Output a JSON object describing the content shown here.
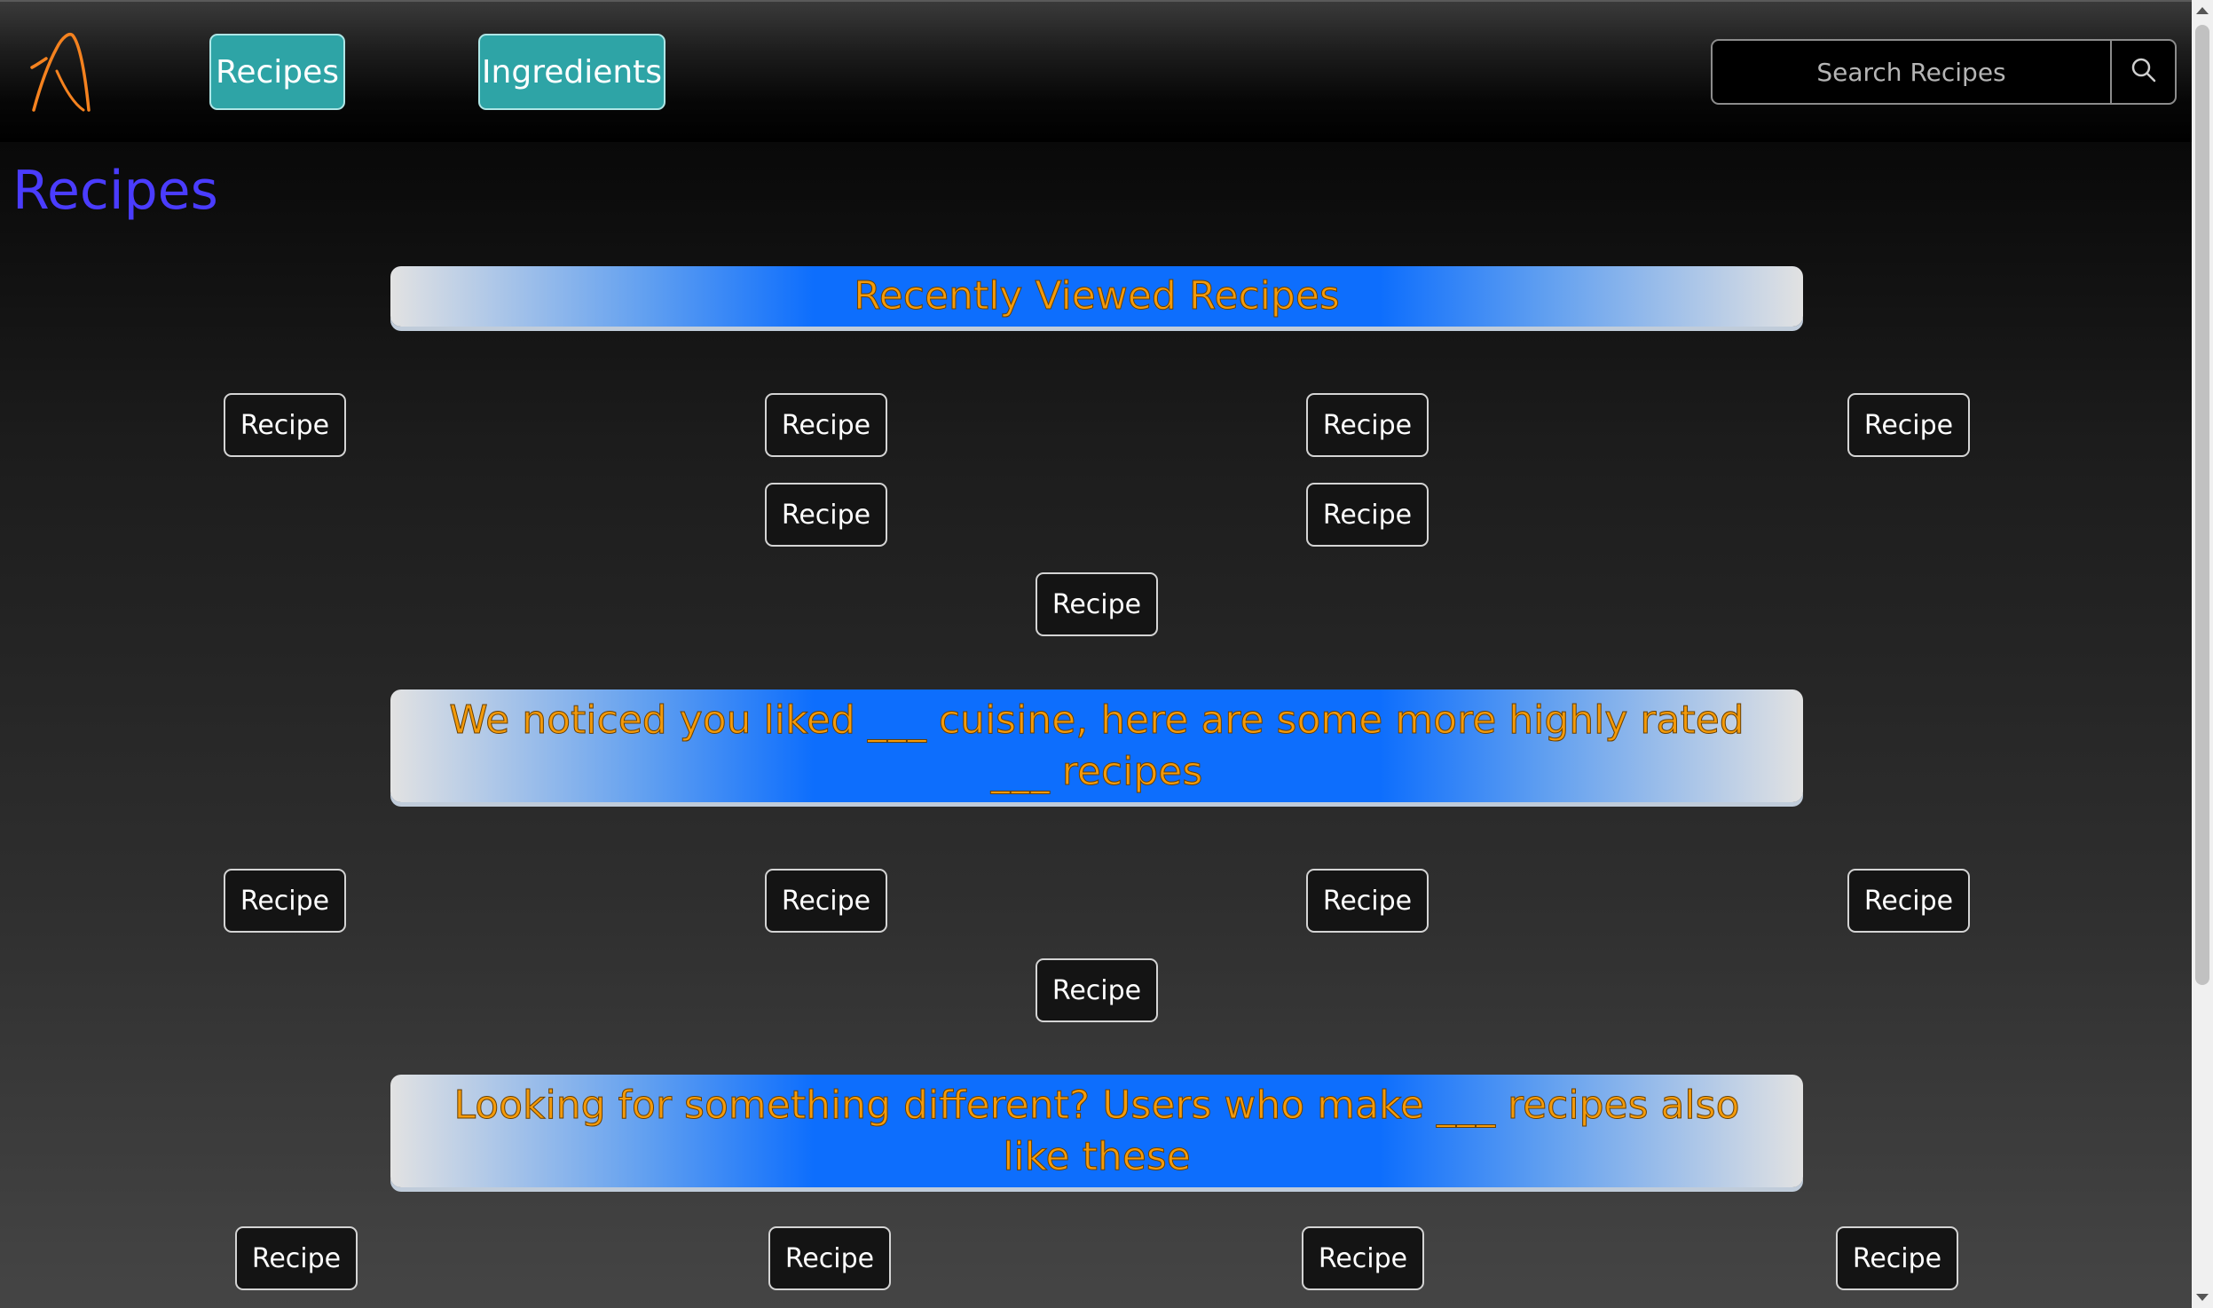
{
  "nav": {
    "recipes_label": "Recipes",
    "ingredients_label": "Ingredients",
    "search_placeholder": "Search Recipes",
    "logo_color": "#f5821f",
    "accent_color": "#2ea4a6"
  },
  "page": {
    "title": "Recipes",
    "title_color": "#4a3cff"
  },
  "sections": [
    {
      "heading": "Recently Viewed Recipes",
      "recipes": [
        "Recipe",
        "Recipe",
        "Recipe",
        "Recipe",
        "Recipe",
        "Recipe",
        "Recipe"
      ]
    },
    {
      "heading": "We noticed you liked ___ cuisine, here are some more highly rated ___ recipes",
      "recipes": [
        "Recipe",
        "Recipe",
        "Recipe",
        "Recipe",
        "Recipe"
      ]
    },
    {
      "heading": "Looking for something different? Users who make ___ recipes also like these",
      "recipes": [
        "Recipe",
        "Recipe",
        "Recipe",
        "Recipe"
      ]
    }
  ],
  "icons": {
    "logo": "a-logo-icon",
    "search": "search-icon"
  }
}
